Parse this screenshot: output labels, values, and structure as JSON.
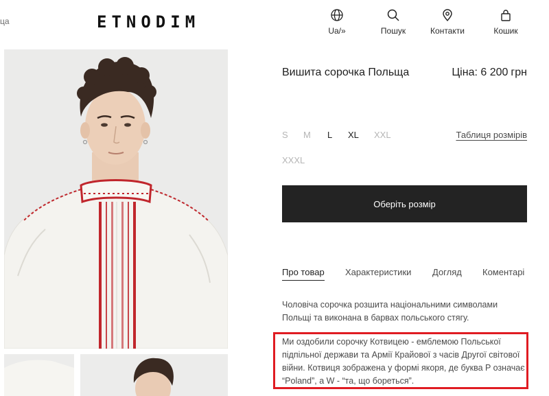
{
  "header": {
    "breadcrumb_stub": "ца",
    "logo": "ETNODIM",
    "nav": [
      {
        "label": "Ua/»",
        "icon": "globe-icon"
      },
      {
        "label": "Пошук",
        "icon": "search-icon"
      },
      {
        "label": "Контакти",
        "icon": "location-pin-icon"
      },
      {
        "label": "Кошик",
        "icon": "shopping-bag-icon"
      }
    ]
  },
  "product": {
    "title": "Вишита сорочка Польща",
    "price_label": "Ціна:",
    "price_value": "6 200",
    "currency": "грн",
    "sizes": [
      {
        "label": "S",
        "available": false
      },
      {
        "label": "M",
        "available": false
      },
      {
        "label": "L",
        "available": true
      },
      {
        "label": "XL",
        "available": true
      },
      {
        "label": "XXL",
        "available": false
      },
      {
        "label": "XXXL",
        "available": false
      }
    ],
    "size_table_link": "Таблиця розмірів",
    "select_size_button": "Оберіть розмір"
  },
  "tabs": [
    {
      "label": "Про товар",
      "active": true
    },
    {
      "label": "Характеристики",
      "active": false
    },
    {
      "label": "Догляд",
      "active": false
    },
    {
      "label": "Коментарі",
      "active": false
    }
  ],
  "description": {
    "paragraph_1": "Чоловіча сорочка розшита національними символами Польщі та виконана в барвах польського стягу.",
    "paragraph_2": "Ми оздобили сорочку Котвицею - емблемою Польської підпільної держави та Армії Крайової з часів Другої світової війни. Котвиця зображена у формі якоря, де буква P означає “Poland”, а W - “та, що бореться”."
  },
  "colors": {
    "button_bg": "#232323",
    "highlight_border": "#e01b22",
    "embroidery_red": "#c0262c",
    "shirt_white": "#f4f3ef"
  }
}
